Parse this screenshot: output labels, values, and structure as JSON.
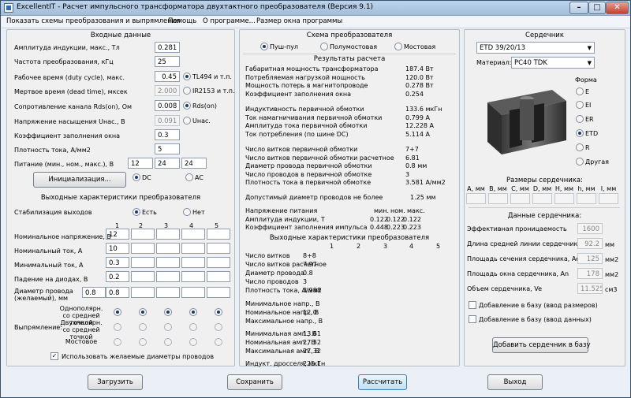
{
  "window": {
    "title": "ExcellentIT - Расчет импульсного трансформатора двухтактного преобразователя (Версия 9.1)",
    "min": "–",
    "max": "□",
    "close": "✕"
  },
  "menu": [
    "Показать схемы преобразования и выпрямления",
    "Помощь",
    "О программе...",
    "Размер окна программы"
  ],
  "input": {
    "title": "Входные данные",
    "fields": [
      {
        "label": "Амплитуда индукции, макс., Тл",
        "value": "0.281"
      },
      {
        "label": "Частота преобразования, кГц",
        "value": "25"
      },
      {
        "label": "Рабочее время (duty cycle), макс.",
        "value": "0.45"
      },
      {
        "label": "Мертвое время (dead time), мксек",
        "value": "2.000"
      },
      {
        "label": "Сопротивление канала Rds(on), Ом",
        "value": "0.008"
      },
      {
        "label": "Напряжение насыщения Uнас., В",
        "value": "0.091"
      },
      {
        "label": "Коэффициент заполнения окна",
        "value": "0.3"
      },
      {
        "label": "Плотность тока, А/мм2",
        "value": "5"
      }
    ],
    "ctrl_options": [
      "TL494 и т.п.",
      "IR2153 и т.п.",
      "Rds(on)",
      "Uнас."
    ],
    "supply_label": "Питание (мин., ном., макс.), В",
    "supply": [
      "12",
      "24",
      "24"
    ],
    "init_button": "Инициализация...",
    "dc": "DC",
    "ac": "AC"
  },
  "output": {
    "title": "Выходные характеристики преобразователя",
    "stab_label": "Стабилизация выходов",
    "stab_yes": "Есть",
    "stab_no": "Нет",
    "cols": [
      "1",
      "2",
      "3",
      "4",
      "5"
    ],
    "rows": [
      {
        "label": "Номинальное напряжение, В",
        "v1": "12"
      },
      {
        "label": "Номинальный ток, А",
        "v1": "10"
      },
      {
        "label": "Минимальный ток, А",
        "v1": "0.3"
      },
      {
        "label": "Падение на диодах, В",
        "v1": "0.2"
      },
      {
        "label": "Диаметр провода (желаемый), мм",
        "v1": "0.8"
      }
    ],
    "wire_left": "0.8",
    "rect_label": "Выпрямление:",
    "rect_options": [
      "Однополярн. со средней точкой",
      "Двухполярн. со средней точкой",
      "Мостовое"
    ],
    "use_wire": "Использовать желаемые диаметры проводов"
  },
  "scheme": {
    "title": "Схема преобразователя",
    "options": [
      "Пуш-пул",
      "Полумостовая",
      "Мостовая"
    ]
  },
  "results": {
    "title": "Результаты расчета",
    "group1": [
      {
        "label": "Габаритная мощность трансформатора",
        "value": "187.4 Вт"
      },
      {
        "label": "Потребляемая нагрузкой мощность",
        "value": "120.0 Вт"
      },
      {
        "label": "Мощность потерь в магнитопроводе",
        "value": "0.278 Вт"
      },
      {
        "label": "Коэффициент заполнения окна",
        "value": "0.254"
      }
    ],
    "group2": [
      {
        "label": "Индуктивность первичной обмотки",
        "value": "133.6 мкГн"
      },
      {
        "label": "Ток намагничивания первичной обмотки",
        "value": "0.799 А"
      },
      {
        "label": "Амплитуда тока первичной обмотки",
        "value": "12.228 А"
      },
      {
        "label": "Ток потребления (по шине DC)",
        "value": "5.114 А"
      }
    ],
    "group3": [
      {
        "label": "Число витков первичной обмотки",
        "value": "7+7"
      },
      {
        "label": "Число витков первичной обмотки расчетное",
        "value": "6.81"
      },
      {
        "label": "Диаметр провода первичной обмотки",
        "value": "0.8 мм"
      },
      {
        "label": "Число проводов в первичной обмотке",
        "value": "3"
      },
      {
        "label": "Плотность тока в первичной обмотке",
        "value": "3.581 А/мм2"
      }
    ],
    "allowed": {
      "label": "Допустимый диаметр проводов не более",
      "value": "1.25 мм"
    },
    "tri_heads": [
      "мин.",
      "ном.",
      "макс."
    ],
    "tri": [
      {
        "label": "Напряжение питания",
        "v": [
          "",
          "",
          ""
        ]
      },
      {
        "label": "Амплитуда индукции, Т",
        "v": [
          "0.122",
          "0.122",
          "0.122"
        ]
      },
      {
        "label": "Коэффициент заполнения импульса",
        "v": [
          "0.448",
          "0.223",
          "0.223"
        ]
      }
    ],
    "out_title": "Выходные характеристики преобразователя",
    "out_cols": [
      "1",
      "2",
      "3",
      "4",
      "5"
    ],
    "out_rows1": [
      {
        "label": "Число витков",
        "value": "8+8"
      },
      {
        "label": "Число витков расчетное",
        "value": "7.97"
      },
      {
        "label": "Диаметр провода",
        "value": "0.8"
      },
      {
        "label": "Число проводов",
        "value": "3"
      },
      {
        "label": "Плотность тока, А/мм2",
        "value": "3.988"
      }
    ],
    "out_rows2": [
      {
        "label": "Минимальное напр., В",
        "value": ""
      },
      {
        "label": "Номинальное напр., В",
        "value": "12.0"
      },
      {
        "label": "Максимальное напр., В",
        "value": ""
      }
    ],
    "out_rows3": [
      {
        "label": "Минимальная амп., В",
        "value": "13.61"
      },
      {
        "label": "Номинальная амп., В",
        "value": "27.32"
      },
      {
        "label": "Максимальная амп., В",
        "value": "27.32"
      }
    ],
    "choke": {
      "label": "Индукт. дросселя, мкГн",
      "value": "225.1"
    }
  },
  "core": {
    "title": "Сердечник",
    "selected": "ETD 39/20/13",
    "material_label": "Материал:",
    "material": "PC40 TDK",
    "form_label": "Форма",
    "forms": [
      "E",
      "EI",
      "ER",
      "ETD",
      "R",
      "Другая"
    ],
    "dims_title": "Размеры сердечника:",
    "dims": [
      "A, мм",
      "B, мм",
      "C, мм",
      "D, мм",
      "H, мм",
      "h, мм",
      "I, мм"
    ],
    "data_title": "Данные сердечника:",
    "data": [
      {
        "label": "Эффективная проницаемость",
        "value": "1600",
        "unit": ""
      },
      {
        "label": "Длина средней линии сердечника, le",
        "value": "92.2",
        "unit": "мм"
      },
      {
        "label": "Площадь сечения сердечника, Ae",
        "value": "125",
        "unit": "мм2"
      },
      {
        "label": "Площадь окна сердечника, An",
        "value": "178",
        "unit": "мм2"
      },
      {
        "label": "Объем сердечника, Ve",
        "value": "11.525",
        "unit": "см3"
      }
    ],
    "add_dims": "Добавление в базу (ввод размеров)",
    "add_data": "Добавление в базу (ввод данных)",
    "add_button": "Добавить сердечник в базу"
  },
  "footer": {
    "load": "Загрузить",
    "save": "Сохранить",
    "calc": "Рассчитать",
    "exit": "Выход"
  }
}
